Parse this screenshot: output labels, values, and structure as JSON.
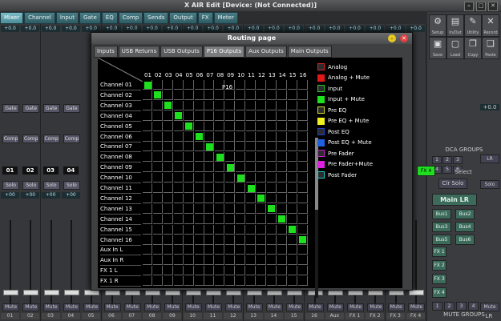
{
  "window": {
    "title": "X AIR Edit [Device: (Not Connected)]",
    "min": "–",
    "max": "□",
    "close": "✕"
  },
  "tabs": [
    "Mixer",
    "Channel",
    "Input",
    "Gate",
    "EQ",
    "Comp",
    "Sends",
    "Output",
    "FX",
    "Meter"
  ],
  "active_tab": "Mixer",
  "strips": [
    {
      "val": "+0.0",
      "gate": "Gate",
      "comp": "Comp",
      "num": "01",
      "solo": "Solo",
      "gain": "+00",
      "label": "01",
      "mute": "Mute"
    },
    {
      "val": "+0.0",
      "gate": "Gate",
      "comp": "Comp",
      "num": "02",
      "solo": "Solo",
      "gain": "+00",
      "label": "02",
      "mute": "Mute"
    },
    {
      "val": "+0.0",
      "gate": "Gate",
      "comp": "Comp",
      "num": "03",
      "solo": "Solo",
      "gain": "+00",
      "label": "03",
      "mute": "Mute"
    },
    {
      "val": "+0.0",
      "gate": "Gate",
      "comp": "Comp",
      "num": "04",
      "solo": "Solo",
      "gain": "+00",
      "label": "04",
      "mute": "Mute"
    },
    {
      "val": "+0.0",
      "gate": "",
      "comp": "",
      "num": "",
      "solo": "",
      "gain": "",
      "label": "05",
      "mute": "Mute"
    },
    {
      "val": "+0.0",
      "gate": "",
      "comp": "",
      "num": "",
      "solo": "",
      "gain": "",
      "label": "06",
      "mute": "Mute"
    },
    {
      "val": "+0.0",
      "gate": "",
      "comp": "",
      "num": "",
      "solo": "",
      "gain": "",
      "label": "07",
      "mute": "Mute"
    },
    {
      "val": "+0.0",
      "gate": "",
      "comp": "",
      "num": "",
      "solo": "",
      "gain": "",
      "label": "08",
      "mute": "Mute"
    },
    {
      "val": "+0.0",
      "gate": "",
      "comp": "",
      "num": "",
      "solo": "",
      "gain": "",
      "label": "09",
      "mute": "Mute"
    },
    {
      "val": "+0.0",
      "gate": "",
      "comp": "",
      "num": "",
      "solo": "",
      "gain": "",
      "label": "10",
      "mute": "Mute"
    },
    {
      "val": "+0.0",
      "gate": "",
      "comp": "",
      "num": "",
      "solo": "",
      "gain": "",
      "label": "11",
      "mute": "Mute"
    },
    {
      "val": "+0.0",
      "gate": "",
      "comp": "",
      "num": "",
      "solo": "",
      "gain": "",
      "label": "12",
      "mute": "Mute"
    },
    {
      "val": "+0.0",
      "gate": "",
      "comp": "",
      "num": "",
      "solo": "",
      "gain": "",
      "label": "13",
      "mute": "Mute"
    },
    {
      "val": "+0.0",
      "gate": "",
      "comp": "",
      "num": "",
      "solo": "",
      "gain": "",
      "label": "14",
      "mute": "Mute"
    },
    {
      "val": "+0.0",
      "gate": "",
      "comp": "",
      "num": "",
      "solo": "",
      "gain": "",
      "label": "15",
      "mute": "Mute"
    },
    {
      "val": "+0.0",
      "gate": "",
      "comp": "",
      "num": "",
      "solo": "",
      "gain": "",
      "label": "16",
      "mute": "Mute"
    },
    {
      "val": "+0.0",
      "gate": "",
      "comp": "",
      "num": "",
      "solo": "",
      "gain": "",
      "label": "Aux",
      "mute": "Mute"
    },
    {
      "val": "+0.0",
      "gate": "",
      "comp": "",
      "num": "",
      "solo": "",
      "gain": "",
      "label": "FX 1",
      "mute": "Mute"
    },
    {
      "val": "+0.0",
      "gate": "",
      "comp": "",
      "num": "",
      "solo": "",
      "gain": "",
      "label": "FX 2",
      "mute": "Mute"
    },
    {
      "val": "+0.0",
      "gate": "",
      "comp": "Comp",
      "num": "FX 4",
      "solo": "Solo",
      "gain": "+00",
      "label": "FX 3",
      "mute": "Mute"
    },
    {
      "val": "+0.0",
      "gate": "",
      "comp": "",
      "num": "",
      "solo": "",
      "gain": "",
      "label": "FX 4",
      "mute": "Mute"
    }
  ],
  "right_panel": {
    "tools": [
      {
        "icon": "⚙",
        "label": "Setup"
      },
      {
        "icon": "▤",
        "label": "In/Out"
      },
      {
        "icon": "✎",
        "label": "Utility"
      },
      {
        "icon": "✕",
        "label": "Record"
      },
      {
        "icon": "▣",
        "label": "Save"
      },
      {
        "icon": "▢",
        "label": "Load"
      },
      {
        "icon": "❐",
        "label": "Copy"
      },
      {
        "icon": "❑",
        "label": "Paste"
      }
    ],
    "dca_title": "DCA GROUPS",
    "dca": [
      "1",
      "2",
      "3",
      "4",
      "5",
      "6"
    ],
    "select": "Select",
    "fx4": "FX 4",
    "lr": "LR",
    "clr_solo": "Clr Solo",
    "solo": "Solo",
    "gain": "+00",
    "main_lr": "Main LR",
    "buses": [
      "Bus1",
      "Bus2",
      "Bus3",
      "Bus4",
      "Bus5",
      "Bus6"
    ],
    "fx_buttons": [
      "FX 1",
      "FX 2",
      "FX 3",
      "FX 4"
    ],
    "mute_groups_title": "MUTE GROUPS",
    "mute_groups": [
      "1",
      "2",
      "3",
      "4"
    ],
    "lr_mute": "Mute",
    "lr_label": "LR",
    "lr_val": "+0.0"
  },
  "routing": {
    "title": "Routing page",
    "tabs": [
      "Inputs",
      "USB Returns",
      "USB Outputs",
      "P16 Outputs",
      "Aux Outputs",
      "Main Outputs"
    ],
    "active_tab": "P16 Outputs",
    "header": "P16",
    "columns": [
      "01",
      "02",
      "03",
      "04",
      "05",
      "06",
      "07",
      "08",
      "09",
      "10",
      "11",
      "12",
      "13",
      "14",
      "15",
      "16"
    ],
    "rows": [
      "Channel 01",
      "Channel 02",
      "Channel 03",
      "Channel 04",
      "Channel 05",
      "Channel 06",
      "Channel 07",
      "Channel 08",
      "Channel 09",
      "Channel 10",
      "Channel 11",
      "Channel 12",
      "Channel 13",
      "Channel 14",
      "Channel 15",
      "Channel 16",
      "Aux In L",
      "Aux In R",
      "FX 1 L",
      "FX 1 R"
    ],
    "active_routes": [
      [
        0,
        0
      ],
      [
        1,
        1
      ],
      [
        2,
        2
      ],
      [
        3,
        3
      ],
      [
        4,
        4
      ],
      [
        5,
        5
      ],
      [
        6,
        6
      ],
      [
        7,
        7
      ],
      [
        8,
        8
      ],
      [
        9,
        9
      ],
      [
        10,
        10
      ],
      [
        11,
        11
      ],
      [
        12,
        12
      ],
      [
        13,
        13
      ],
      [
        14,
        14
      ],
      [
        15,
        15
      ]
    ],
    "route_color": "#1ee01e",
    "legend": [
      {
        "label": "Analog",
        "color": "#2b2d2f",
        "border": "#d22"
      },
      {
        "label": "Analog + Mute",
        "color": "#e01818",
        "border": "#e01818"
      },
      {
        "label": "Input",
        "color": "#2b2d2f",
        "border": "#2c2"
      },
      {
        "label": "Input + Mute",
        "color": "#1ee01e",
        "border": "#1ee01e"
      },
      {
        "label": "Pre EQ",
        "color": "#2b2d2f",
        "border": "#dd2"
      },
      {
        "label": "Pre EQ + Mute",
        "color": "#f0f020",
        "border": "#f0f020"
      },
      {
        "label": "Post EQ",
        "color": "#2b2d2f",
        "border": "#24c"
      },
      {
        "label": "Post EQ + Mute",
        "color": "#2060e0",
        "border": "#2060e0"
      },
      {
        "label": "Pre Fader",
        "color": "#2b2d2f",
        "border": "#c2c"
      },
      {
        "label": "Pre Fader+Mute",
        "color": "#e020e0",
        "border": "#e020e0"
      },
      {
        "label": "Post Fader",
        "color": "#2b2d2f",
        "border": "#2cc"
      }
    ]
  }
}
